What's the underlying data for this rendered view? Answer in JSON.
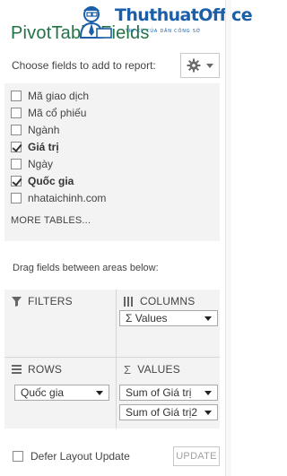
{
  "pane": {
    "title": "PivotTable Fields",
    "choose_label": "Choose fields to add to report:"
  },
  "logo": {
    "name": "ThuthuatOffice",
    "tagline": "TRI KỸ CỦA DÂN CÔNG SỞ"
  },
  "fields": [
    {
      "label": "Mã giao dịch",
      "checked": false
    },
    {
      "label": "Mã cổ phiếu",
      "checked": false
    },
    {
      "label": "Ngành",
      "checked": false
    },
    {
      "label": "Giá trị",
      "checked": true
    },
    {
      "label": "Ngày",
      "checked": false
    },
    {
      "label": "Quốc gia",
      "checked": true
    },
    {
      "label": "nhataichinh.com",
      "checked": false
    }
  ],
  "more_tables": "MORE TABLES...",
  "drag_label": "Drag fields between areas below:",
  "areas": {
    "filters": {
      "label": "FILTERS",
      "items": []
    },
    "columns": {
      "label": "COLUMNS",
      "items": [
        "Σ Values"
      ]
    },
    "rows": {
      "label": "ROWS",
      "items": [
        "Quốc gia"
      ]
    },
    "values": {
      "label": "VALUES",
      "items": [
        "Sum of Giá trị",
        "Sum of Giá trị2"
      ]
    }
  },
  "footer": {
    "defer_label": "Defer Layout Update",
    "defer_checked": false,
    "update_label": "UPDATE"
  },
  "colors": {
    "title": "#217346",
    "area_bg": "#f3f3f3",
    "logo": "#1b5fa8"
  },
  "icons": [
    "gear-icon",
    "dropdown-caret-icon",
    "filter-icon",
    "columns-icon",
    "rows-icon",
    "sigma-icon"
  ]
}
